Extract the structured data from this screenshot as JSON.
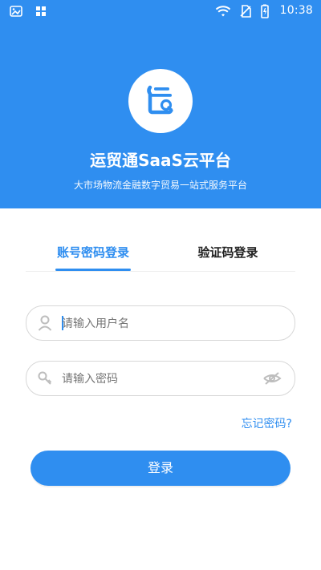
{
  "status": {
    "time": "10:38"
  },
  "header": {
    "app_title": "运贸通SaaS云平台",
    "subtitle": "大市场物流金融数字贸易一站式服务平台"
  },
  "tabs": {
    "items": [
      {
        "label": "账号密码登录",
        "active": true
      },
      {
        "label": "验证码登录",
        "active": false
      }
    ]
  },
  "form": {
    "username_placeholder": "请输入用户名",
    "password_placeholder": "请输入密码",
    "forgot_label": "忘记密码?",
    "login_label": "登录"
  },
  "colors": {
    "primary": "#2f8ef0",
    "white": "#ffffff"
  },
  "icons": {
    "logo": "yun-logo-icon",
    "image_status": "image-icon",
    "grid_status": "grid-icon",
    "wifi": "wifi-icon",
    "no_sim": "no-sim-icon",
    "battery": "battery-icon",
    "user": "user-icon",
    "key": "key-icon",
    "eye": "eye-slash-icon"
  }
}
